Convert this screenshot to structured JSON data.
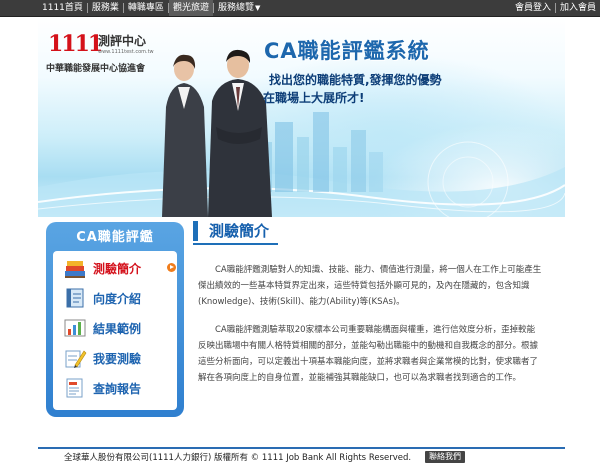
{
  "nav": {
    "left": [
      "1111首頁",
      "服務業",
      "轉職專區",
      "觀光旅遊",
      "服務總覽"
    ],
    "right": [
      "會員登入",
      "加入會員"
    ]
  },
  "banner": {
    "logo_number": "1111",
    "logo_text": "測評中心",
    "logo_url": "www.1111test.com.tw",
    "association": "中華職能發展中心協進會",
    "system_title": "CA職能評鑑系統",
    "slogan_line1": "找出您的職能特質,發揮您的優勢",
    "slogan_line2": "在職場上大展所才!"
  },
  "sidebar": {
    "title": "CA職能評鑑",
    "items": [
      {
        "label": "測驗簡介",
        "icon": "books-icon",
        "active": true
      },
      {
        "label": "向度介紹",
        "icon": "notebook-icon",
        "active": false
      },
      {
        "label": "結果範例",
        "icon": "chart-icon",
        "active": false
      },
      {
        "label": "我要測驗",
        "icon": "pencil-paper-icon",
        "active": false
      },
      {
        "label": "查詢報告",
        "icon": "report-icon",
        "active": false
      }
    ]
  },
  "content": {
    "title": "測驗簡介",
    "paragraph1": "CA職能評鑑測驗對人的知識、技能、能力、價值進行測量，將一個人在工作上可能產生傑出績效的一些基本特質界定出來，這些特質包括外顯可見的，及內在隱藏的，包含知識(Knowledge)、技術(Skill)、能力(Ability)等(KSAs)。",
    "paragraph2": "CA職能評鑑測驗萃取20家標本公司重要職能構面與權重，進行信效度分析，歪掉較能反映出職場中有關人格特質相關的部分，並能勾勒出職能中的動機和自我概念的部分。根據這些分析面向，可以定義出十項基本職能向度，並將求職者與企業常模的比對，使求職者了解在各項向度上的自身位置，並能補強其職能缺口，也可以為求職者找到適合的工作。"
  },
  "footer": {
    "copyright": "全球華人股份有限公司(1111人力銀行) 版權所有 © 1111 Job Bank All Rights Reserved.",
    "contact_label": "聯絡我們"
  },
  "colors": {
    "accent_blue": "#1e6fb8",
    "active_red": "#d4121c",
    "nav_bg": "#3c3c3c"
  }
}
